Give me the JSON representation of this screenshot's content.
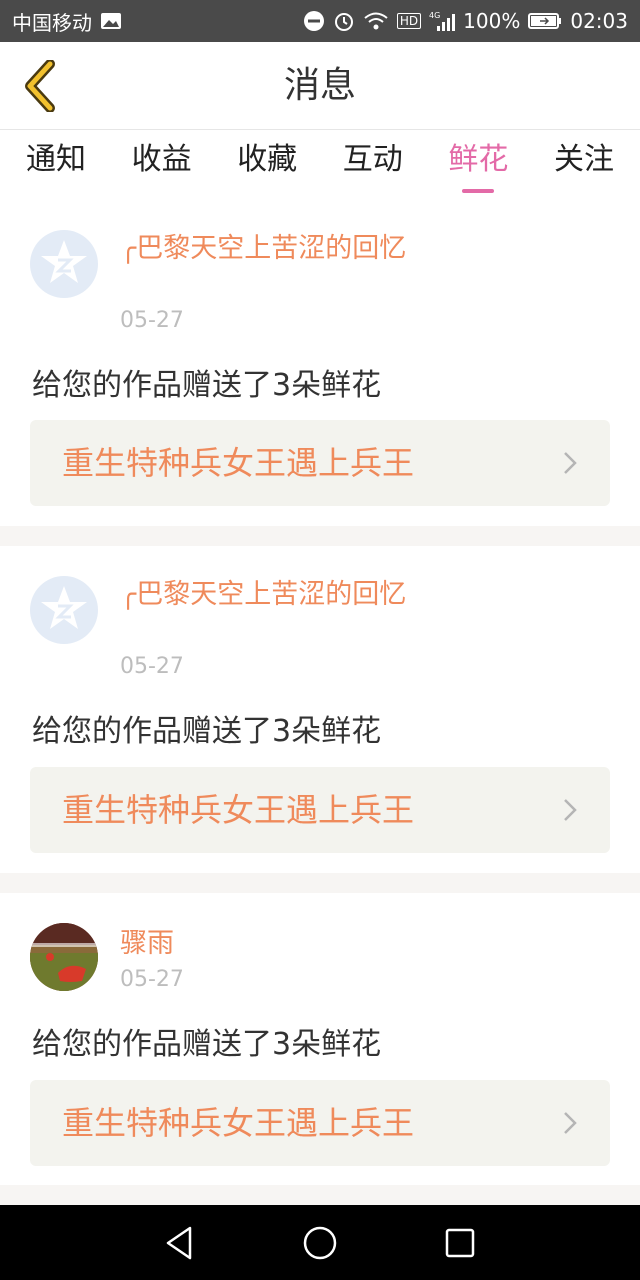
{
  "status_bar": {
    "carrier": "中国移动",
    "battery": "100%",
    "time": "02:03",
    "network": "4G",
    "hd": "HD"
  },
  "header": {
    "title": "消息",
    "back_icon": "chevron-left-icon"
  },
  "tabs": [
    {
      "label": "通知",
      "active": false
    },
    {
      "label": "收益",
      "active": false
    },
    {
      "label": "收藏",
      "active": false
    },
    {
      "label": "互动",
      "active": false
    },
    {
      "label": "鲜花",
      "active": true
    },
    {
      "label": "关注",
      "active": false
    }
  ],
  "items": [
    {
      "user": "╭巴黎天空上苦涩的回忆",
      "date": "05-27",
      "message": "给您的作品赠送了3朵鲜花",
      "book": "重生特种兵女王遇上兵王",
      "avatar": "qq-default-avatar"
    },
    {
      "user": "╭巴黎天空上苦涩的回忆",
      "date": "05-27",
      "message": "给您的作品赠送了3朵鲜花",
      "book": "重生特种兵女王遇上兵王",
      "avatar": "qq-default-avatar"
    },
    {
      "user": "骤雨",
      "date": "05-27",
      "message": "给您的作品赠送了3朵鲜花",
      "book": "重生特种兵女王遇上兵王",
      "avatar": "photo-avatar"
    }
  ],
  "colors": {
    "accent_pink": "#e36aa7",
    "name_orange": "#ef8a5b",
    "back_yellow": "#f2c12e"
  }
}
